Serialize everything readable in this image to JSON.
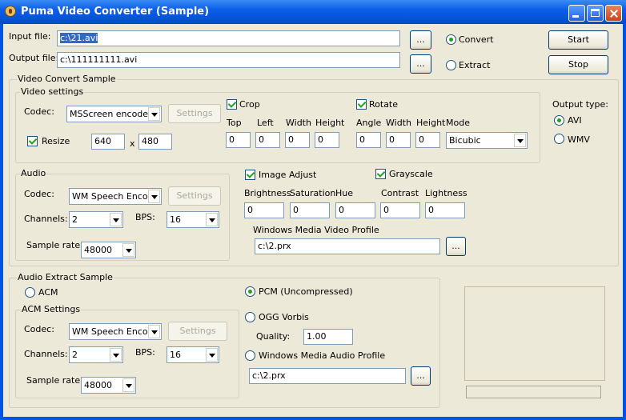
{
  "window": {
    "title": "Puma Video Converter (Sample)"
  },
  "input": {
    "label": "Input file:",
    "value": "c:\\21.avi",
    "browse": "..."
  },
  "output": {
    "label": "Output file:",
    "value": "c:\\111111111.avi",
    "browse": "..."
  },
  "mode": {
    "convert": "Convert",
    "extract": "Extract"
  },
  "actions": {
    "start": "Start",
    "stop": "Stop"
  },
  "video_convert": {
    "title": "Video Convert Sample",
    "video_settings": {
      "title": "Video settings",
      "codec_label": "Codec:",
      "codec_value": "MSScreen encoder D",
      "settings": "Settings",
      "resize_label": "Resize",
      "width": "640",
      "x": "x",
      "height": "480"
    },
    "crop": {
      "label": "Crop",
      "top": "Top",
      "left": "Left",
      "width": "Width",
      "height": "Height",
      "values": [
        "0",
        "0",
        "0",
        "0"
      ]
    },
    "rotate": {
      "label": "Rotate",
      "angle": "Angle",
      "width": "Width",
      "height": "Height",
      "mode": "Mode",
      "values": [
        "0",
        "0",
        "0"
      ],
      "mode_value": "Bicubic"
    },
    "output_type": {
      "label": "Output type:",
      "avi": "AVI",
      "wmv": "WMV"
    },
    "audio": {
      "title": "Audio",
      "codec_label": "Codec:",
      "codec_value": "WM Speech Encode",
      "settings": "Settings",
      "channels_label": "Channels:",
      "channels_value": "2",
      "bps_label": "BPS:",
      "bps_value": "16",
      "rate_label": "Sample rate:",
      "rate_value": "48000"
    },
    "image_adjust": {
      "label": "Image Adjust",
      "grayscale": "Grayscale",
      "brightness": "Brightness",
      "saturation": "Saturation",
      "hue": "Hue",
      "contrast": "Contrast",
      "lightness": "Lightness",
      "values": [
        "0",
        "0",
        "0",
        "0",
        "0"
      ]
    },
    "profile": {
      "label": "Windows Media Video Profile",
      "value": "c:\\2.prx",
      "browse": "..."
    }
  },
  "audio_extract": {
    "title": "Audio Extract Sample",
    "acm": "ACM",
    "acm_settings": {
      "title": "ACM Settings",
      "codec_label": "Codec:",
      "codec_value": "WM Speech Encode",
      "settings": "Settings",
      "channels_label": "Channels:",
      "channels_value": "2",
      "bps_label": "BPS:",
      "bps_value": "16",
      "rate_label": "Sample rate:",
      "rate_value": "48000"
    },
    "pcm": "PCM (Uncompressed)",
    "ogg": "OGG Vorbis",
    "quality_label": "Quality:",
    "quality_value": "1.00",
    "wma": "Windows Media Audio Profile",
    "wma_value": "c:\\2.prx",
    "browse": "..."
  }
}
